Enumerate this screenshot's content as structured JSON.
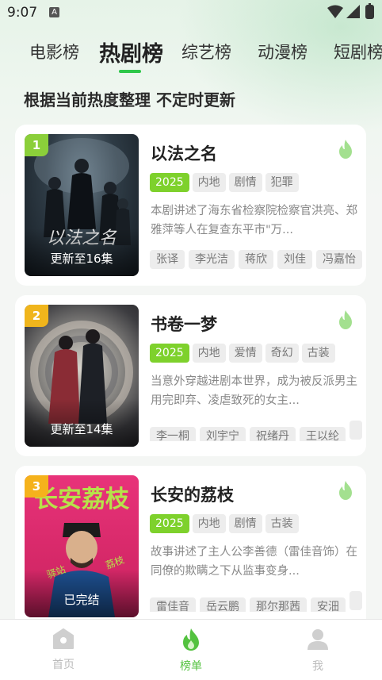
{
  "status_bar": {
    "time": "9:07",
    "notification_icon": "A"
  },
  "tabs": [
    {
      "label": "电影榜",
      "active": false
    },
    {
      "label": "热剧榜",
      "active": true
    },
    {
      "label": "综艺榜",
      "active": false
    },
    {
      "label": "动漫榜",
      "active": false
    },
    {
      "label": "短剧榜",
      "active": false
    }
  ],
  "subtitle": "根据当前热度整理 不定时更新",
  "colors": {
    "accent": "#2ec74a",
    "year_tag": "#7ed12c",
    "rank1": "#8bcf3a",
    "rank2": "#f0b51c",
    "rank3": "#f5b21c",
    "flame": "#9ee08a"
  },
  "items": [
    {
      "rank": "1",
      "title": "以法之名",
      "tags": [
        "2025",
        "内地",
        "剧情",
        "犯罪"
      ],
      "description": "本剧讲述了海东省检察院检察官洪亮、郑雅萍等人在复查东平市\"万...",
      "cast": [
        "张译",
        "李光洁",
        "蒋欣",
        "刘佳",
        "冯嘉怡"
      ],
      "poster_status": "更新至16集"
    },
    {
      "rank": "2",
      "title": "书卷一梦",
      "tags": [
        "2025",
        "内地",
        "爱情",
        "奇幻",
        "古装"
      ],
      "description": "当意外穿越进剧本世界，成为被反派男主用完即弃、凌虐致死的女主...",
      "cast": [
        "李一桐",
        "刘宇宁",
        "祝绪丹",
        "王以纶",
        ""
      ],
      "poster_status": "更新至14集"
    },
    {
      "rank": "3",
      "title": "长安的荔枝",
      "tags": [
        "2025",
        "内地",
        "剧情",
        "古装"
      ],
      "description": "故事讲述了主人公李善德（雷佳音饰）在同僚的欺瞒之下从监事变身...",
      "cast": [
        "雷佳音",
        "岳云鹏",
        "那尔那茜",
        "安沺",
        ""
      ],
      "poster_status": "已完结"
    }
  ],
  "bottom_nav": [
    {
      "label": "首页",
      "icon": "home-icon",
      "active": false
    },
    {
      "label": "榜单",
      "icon": "flame-icon",
      "active": true
    },
    {
      "label": "我",
      "icon": "person-icon",
      "active": false
    }
  ]
}
